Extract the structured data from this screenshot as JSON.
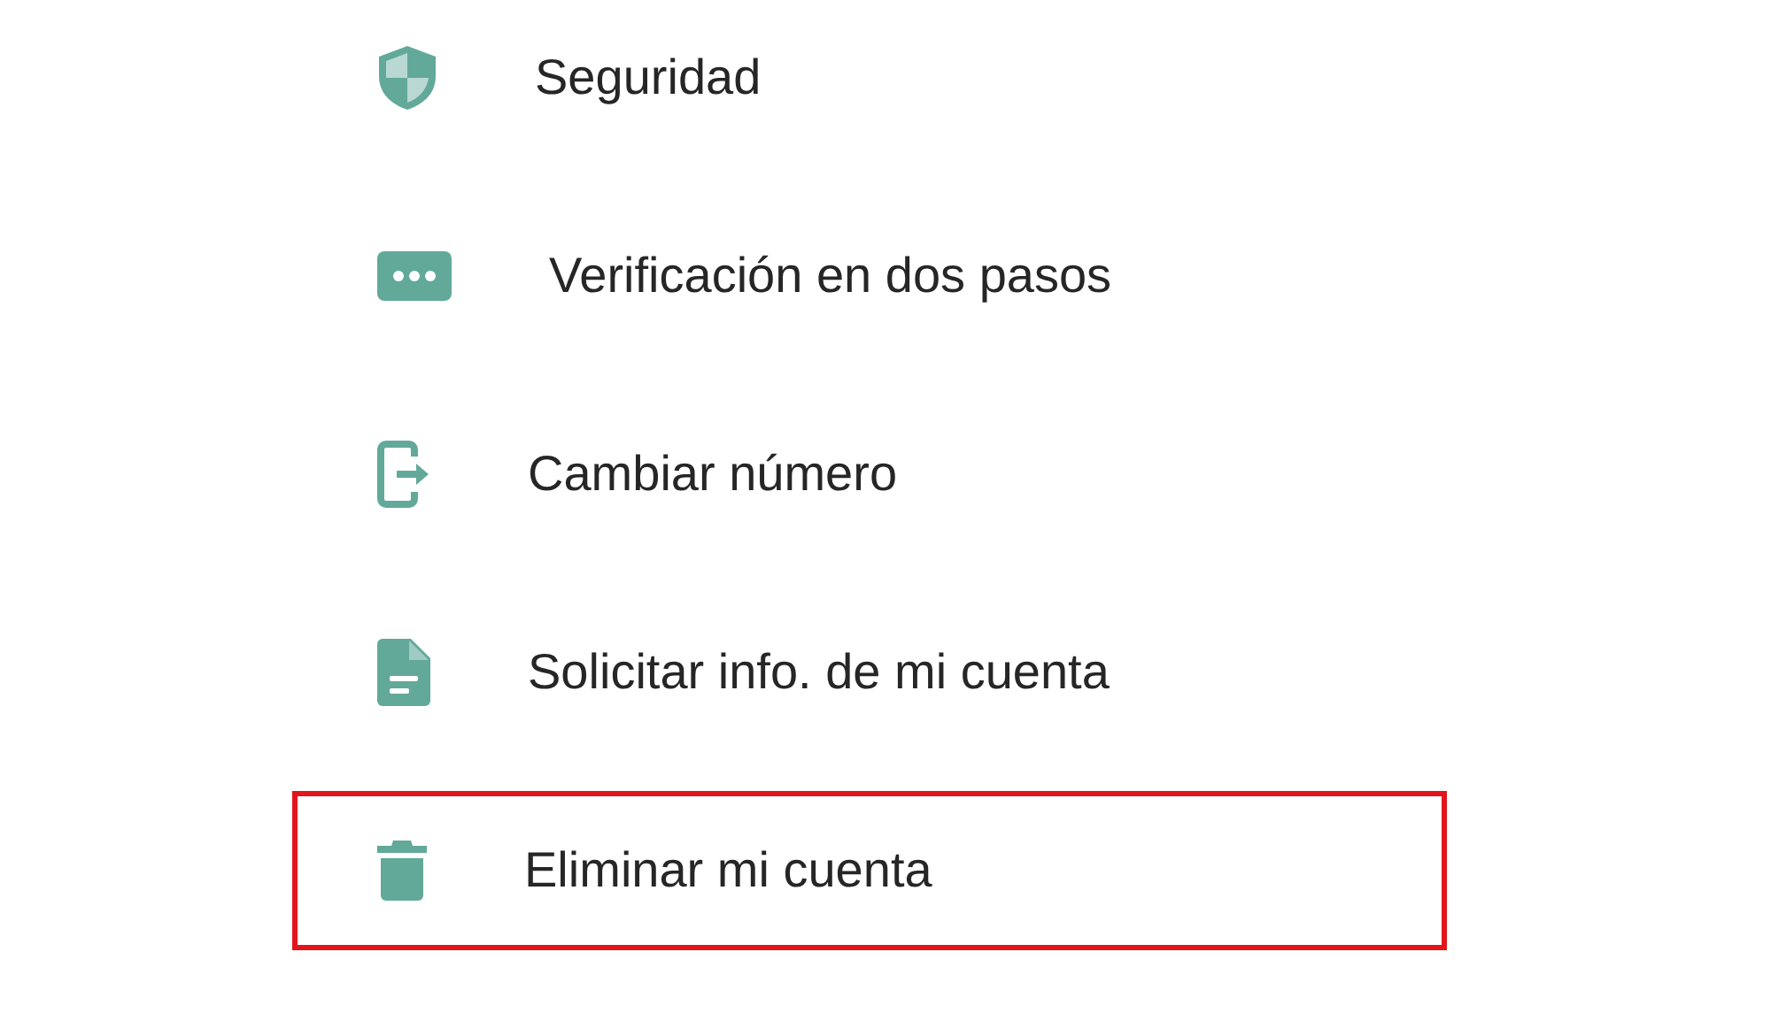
{
  "settings_items": [
    {
      "kind": "shield",
      "label": "Seguridad",
      "highlighted": false
    },
    {
      "kind": "dots",
      "label": "Verificación en dos pasos",
      "highlighted": false
    },
    {
      "kind": "phone-exit",
      "label": "Cambiar número",
      "highlighted": false
    },
    {
      "kind": "document",
      "label": "Solicitar info. de mi cuenta",
      "highlighted": false
    },
    {
      "kind": "trash",
      "label": "Eliminar mi cuenta",
      "highlighted": true
    }
  ]
}
